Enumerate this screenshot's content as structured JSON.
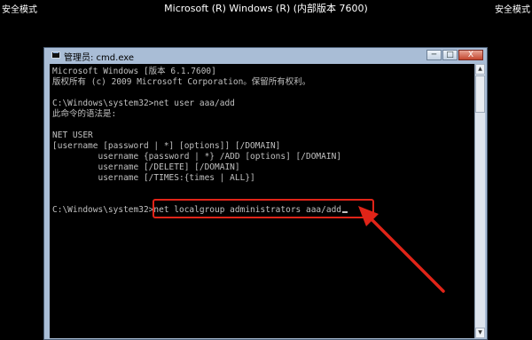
{
  "screen": {
    "safe_mode_left": "安全模式",
    "safe_mode_right": "安全模式",
    "title": "Microsoft (R) Windows (R) (内部版本 7600)"
  },
  "window": {
    "title": "管理员: cmd.exe",
    "controls": {
      "minimize": "─",
      "maximize": "□",
      "close": "X"
    }
  },
  "console": {
    "lines": [
      "Microsoft Windows [版本 6.1.7600]",
      "版权所有 (c) 2009 Microsoft Corporation。保留所有权利。",
      "",
      "C:\\Windows\\system32>net user aaa/add",
      "此命令的语法是:",
      "",
      "NET USER",
      "[username [password | *] [options]] [/DOMAIN]",
      "         username {password | *} /ADD [options] [/DOMAIN]",
      "         username [/DELETE] [/DOMAIN]",
      "         username [/TIMES:{times | ALL}]",
      "",
      "",
      "C:\\Windows\\system32>net localgroup administrators aaa/add"
    ]
  },
  "annotation": {
    "color": "#e02418"
  }
}
